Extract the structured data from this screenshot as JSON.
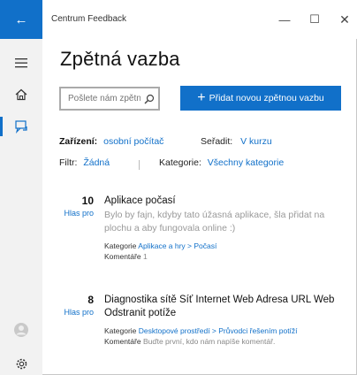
{
  "window": {
    "app_title": "Centrum Feedback",
    "back_glyph": "←",
    "minimize_glyph": "—",
    "maximize_glyph": "☐",
    "close_glyph": "✕"
  },
  "rail": {
    "items": [
      {
        "icon": "hamburger-menu-icon"
      },
      {
        "icon": "home-icon"
      },
      {
        "icon": "feedback-icon",
        "active": true
      },
      {
        "icon": "user-avatar-icon"
      },
      {
        "icon": "settings-gear-icon"
      }
    ]
  },
  "page": {
    "title": "Zpětná vazba"
  },
  "search": {
    "placeholder": "Pošlete nám zpětnou vazbu"
  },
  "add_button": {
    "label": "Přidat novou zpětnou vazbu"
  },
  "filters": {
    "device_label": "Zařízení:",
    "device_value": "osobní počítač",
    "sort_label": "Seřadit:",
    "sort_value": "V kurzu",
    "filter_label": "Filtr:",
    "filter_value": "Žádná",
    "category_label": "Kategorie:",
    "category_value": "Všechny kategorie"
  },
  "feedback_items": [
    {
      "votes": "10",
      "vote_label": "Hlas pro",
      "title": "Aplikace počasí",
      "description": "Bylo by fajn, kdyby tato úžasná aplikace, šla přidat na plochu a aby fungovala online :)",
      "category_label": "Kategorie",
      "category_path": "Aplikace a hry > Počasí",
      "comments_label": "Komentáře",
      "comments_value": "1"
    },
    {
      "votes": "8",
      "vote_label": "Hlas pro",
      "title": "Diagnostika sítě Síť Internet Web Adresa URL Web Odstranit potíže",
      "description": "",
      "category_label": "Kategorie",
      "category_path": "Desktopové prostředí > Průvodci řešením potíží",
      "comments_label": "Komentáře",
      "comments_value": "Buďte první, kdo nám napíše komentář."
    }
  ],
  "colors": {
    "accent": "#1170c9",
    "rail_bg": "#f2f2f2"
  }
}
